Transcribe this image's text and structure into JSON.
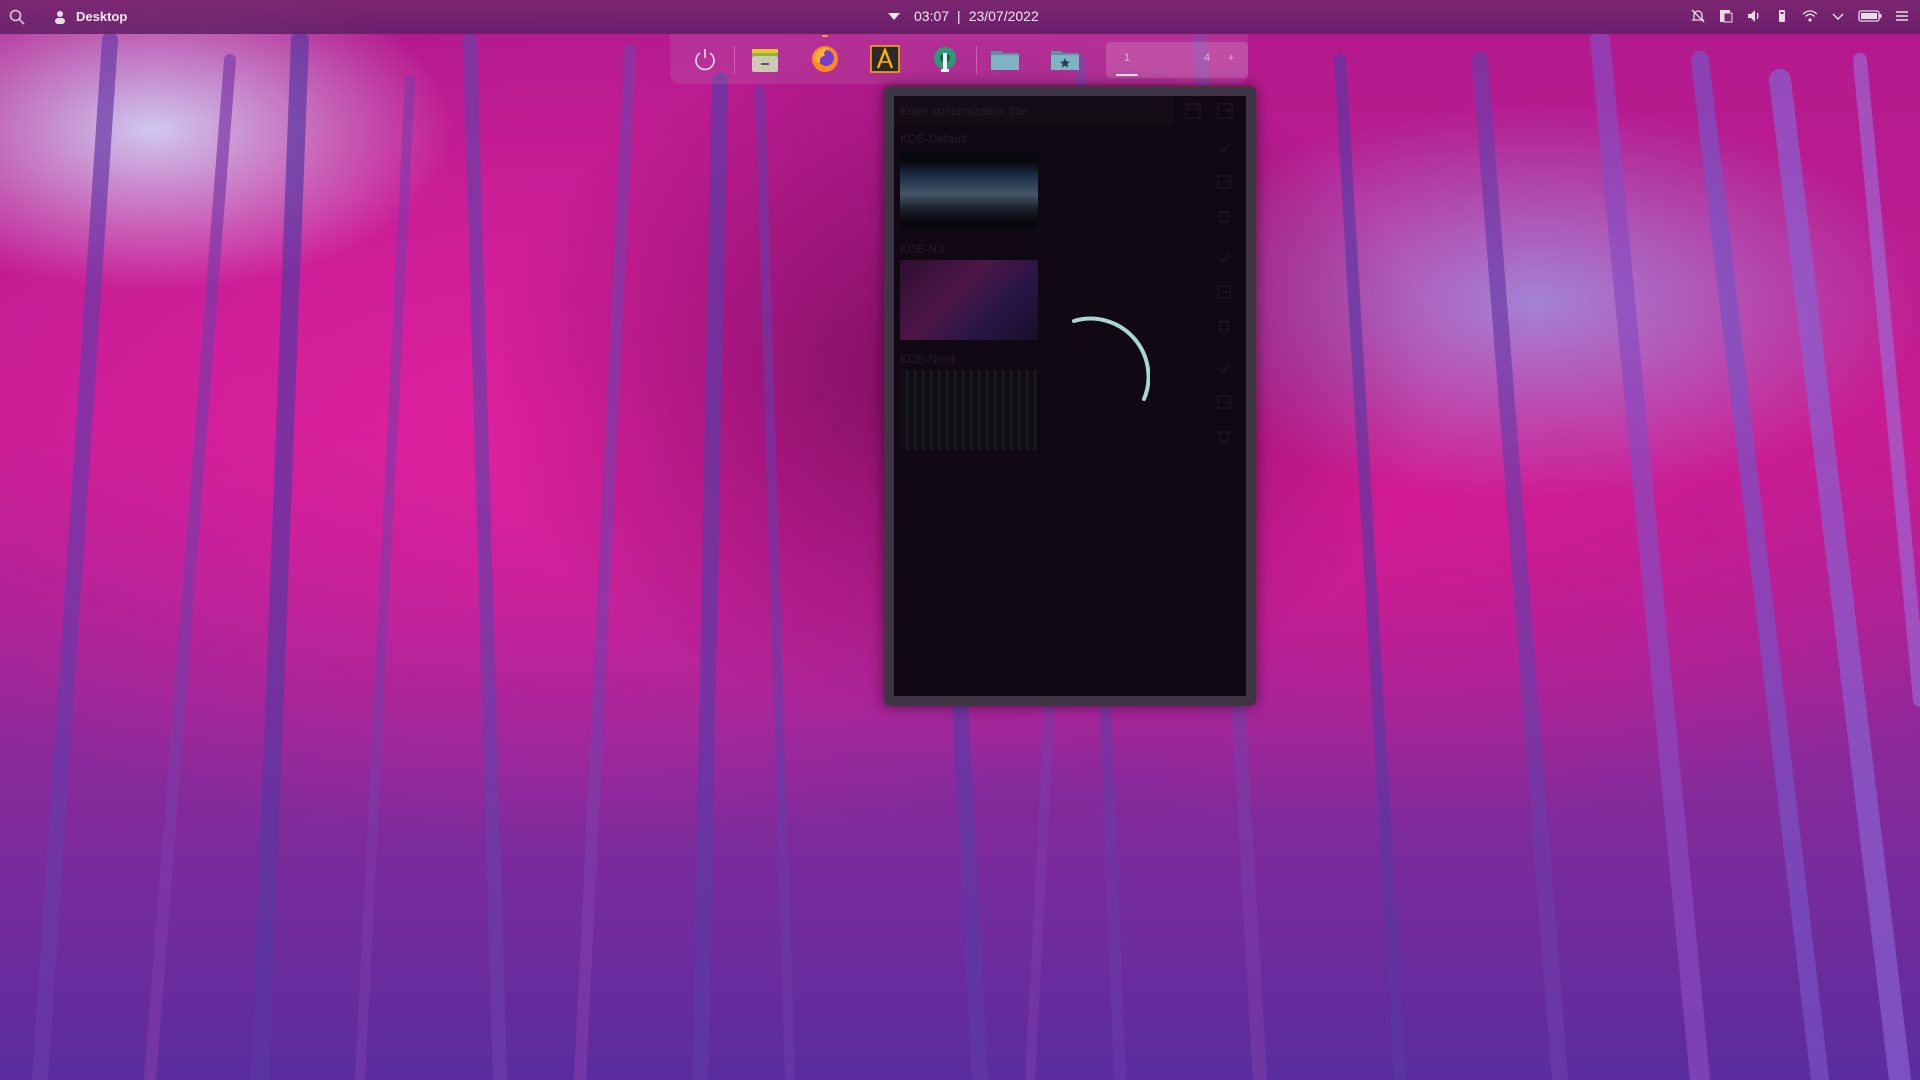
{
  "topbar": {
    "desktop_label": "Desktop",
    "time": "03:07",
    "separator": "|",
    "date": "23/07/2022",
    "icons": {
      "search": "search-icon",
      "desktop": "desktop-icon",
      "notifications": "notifications-off-icon",
      "clipboard": "clipboard-icon",
      "volume": "volume-icon",
      "usb": "usb-icon",
      "wifi": "wifi-icon",
      "expand": "chevron-down-icon",
      "battery": "battery-icon",
      "menu": "hamburger-menu-icon"
    }
  },
  "dock": {
    "items": [
      {
        "name": "power",
        "icon": "power-icon"
      },
      {
        "name": "files-manager",
        "icon": "files-app-icon"
      },
      {
        "name": "firefox",
        "icon": "firefox-icon",
        "running": true
      },
      {
        "name": "anytype",
        "icon": "text-editor-icon"
      },
      {
        "name": "system-settings",
        "icon": "settings-app-icon"
      },
      {
        "name": "folder",
        "icon": "folder-icon"
      },
      {
        "name": "favorites-folder",
        "icon": "star-folder-icon"
      }
    ],
    "pager": {
      "first": "1",
      "last": "4",
      "add": "+"
    }
  },
  "dialog": {
    "title_placeholder": "Enter customization title",
    "entries": [
      {
        "name": "KDE-Default"
      },
      {
        "name": "KDE-NX"
      },
      {
        "name": "KDE-Nord"
      }
    ],
    "loading": true
  },
  "colors": {
    "accent_spinner": "#a9d5d2",
    "topbar_bg": "#7a2870",
    "dialog_bg": "#1a0f1b"
  }
}
